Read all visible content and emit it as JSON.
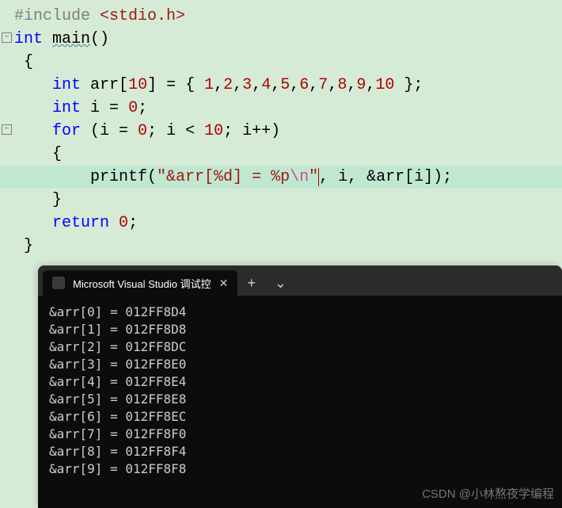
{
  "code": {
    "include_directive": "#include",
    "include_path": "<stdio.h>",
    "kw_int": "int",
    "fn_main": "main",
    "parens": "()",
    "brace_open": "{",
    "decl_arr_pre": "int ",
    "decl_arr_name": "arr",
    "decl_arr_bracket_open": "[",
    "decl_arr_size": "10",
    "decl_arr_bracket_close": "]",
    "decl_arr_eq": " = { ",
    "arr_values": [
      "1",
      "2",
      "3",
      "4",
      "5",
      "6",
      "7",
      "8",
      "9",
      "10"
    ],
    "decl_arr_end": " };",
    "decl_i": "int ",
    "decl_i_name": "i",
    "decl_i_eq": " = ",
    "decl_i_val": "0",
    "decl_i_end": ";",
    "for_kw": "for",
    "for_open": " (i = ",
    "for_init": "0",
    "for_mid1": "; i < ",
    "for_cond": "10",
    "for_mid2": "; i++)",
    "brace_open2": "{",
    "printf_name": "printf",
    "printf_open": "(",
    "printf_str1": "\"&arr[%d] = %p",
    "printf_esc": "\\n",
    "printf_str2": "\"",
    "printf_args": ", i, &arr[i]);",
    "brace_close2": "}",
    "return_kw": "return",
    "return_sp": " ",
    "return_val": "0",
    "return_end": ";",
    "brace_close": "}"
  },
  "terminal": {
    "tab_title": "Microsoft Visual Studio 调试控",
    "output": [
      "&arr[0] = 012FF8D4",
      "&arr[1] = 012FF8D8",
      "&arr[2] = 012FF8DC",
      "&arr[3] = 012FF8E0",
      "&arr[4] = 012FF8E4",
      "&arr[5] = 012FF8E8",
      "&arr[6] = 012FF8EC",
      "&arr[7] = 012FF8F0",
      "&arr[8] = 012FF8F4",
      "&arr[9] = 012FF8F8"
    ]
  },
  "watermark": "CSDN @小林熬夜学编程"
}
